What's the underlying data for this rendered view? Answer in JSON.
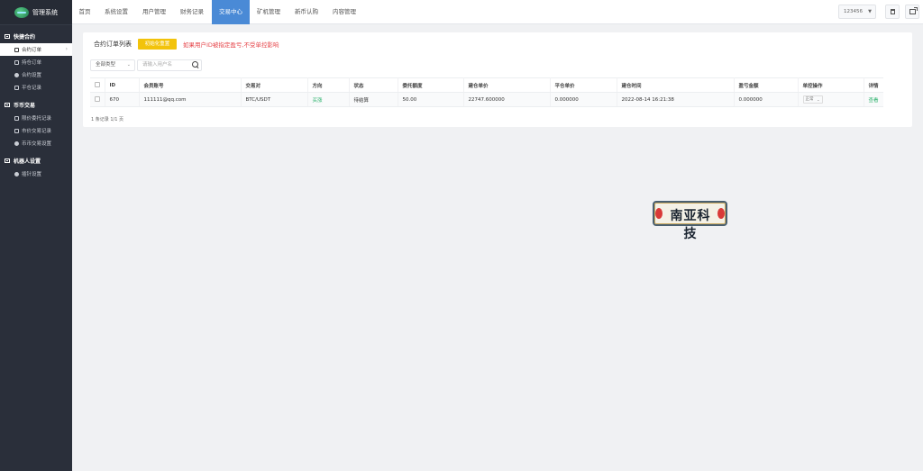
{
  "sidebar": {
    "logo_text": "管理系统",
    "groups": [
      {
        "title": "快捷合约",
        "items": [
          {
            "label": "合约订单"
          },
          {
            "label": "持仓订单"
          },
          {
            "label": "合约设置"
          },
          {
            "label": "平仓记录"
          }
        ]
      },
      {
        "title": "币币交易",
        "items": [
          {
            "label": "限价委托记录"
          },
          {
            "label": "市价交易记录"
          },
          {
            "label": "币币交易设置"
          }
        ]
      },
      {
        "title": "机器人设置",
        "items": [
          {
            "label": "插针设置"
          }
        ]
      }
    ]
  },
  "topbar": {
    "tabs": [
      {
        "label": "首页"
      },
      {
        "label": "系统设置"
      },
      {
        "label": "用户管理"
      },
      {
        "label": "财务记录"
      },
      {
        "label": "交易中心"
      },
      {
        "label": "矿机管理"
      },
      {
        "label": "新币认购"
      },
      {
        "label": "内容管理"
      }
    ],
    "user": "123456"
  },
  "card": {
    "title": "合约订单列表",
    "init_button": "初始化重置",
    "warning": "如果用户ID被指定盈亏,不受单控影响",
    "filter_select": "全部类型",
    "search_placeholder": "请输入用户名",
    "columns": [
      "ID",
      "会员账号",
      "交易对",
      "方向",
      "状态",
      "委托额度",
      "建仓单价",
      "平仓单价",
      "建仓时间",
      "盈亏金额",
      "单控操作",
      "详情"
    ],
    "rows": [
      {
        "id": "670",
        "account": "111111@qq.com",
        "pair": "BTC/USDT",
        "direction": "买涨",
        "status": "待结算",
        "amount": "50.00",
        "open_price": "22747.600000",
        "close_price": "0.000000",
        "open_time": "2022-08-14 16:21:38",
        "pnl": "0.000000",
        "control": "正常",
        "detail": "查看"
      }
    ],
    "pagination": "1 条记录 1/1 页"
  },
  "stamp_text": "南亚科技"
}
